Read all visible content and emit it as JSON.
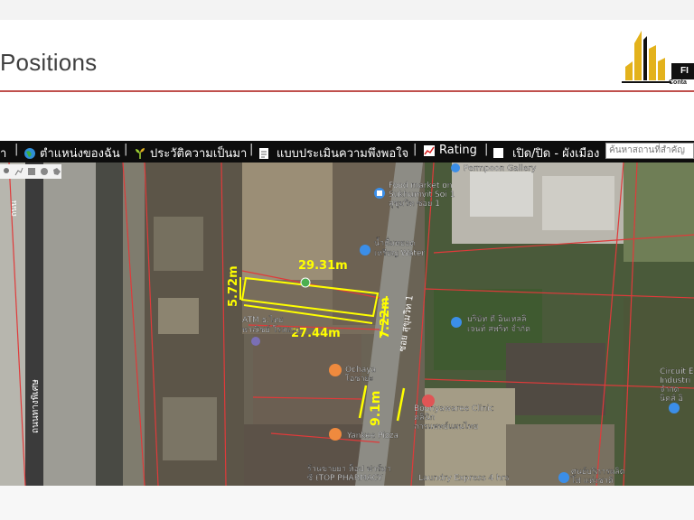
{
  "slide": {
    "title": "Positions",
    "logo_fi": "FI",
    "logo_sub": "Conta"
  },
  "toolbar": {
    "items": [
      {
        "label": "ำ",
        "icon": "truncated-icon"
      },
      {
        "label": "ตำแหน่งของฉัน",
        "icon": "globe-icon"
      },
      {
        "label": "ประวัติความเป็นมา",
        "icon": "sprout-icon"
      },
      {
        "label": "แบบประเมินความพึงพอใจ",
        "icon": "document-icon"
      },
      {
        "label": "Rating",
        "icon": "chart-icon"
      },
      {
        "label": "เปิด/ปิด - ผังเมือง",
        "icon": "square-icon"
      }
    ],
    "search_placeholder": "ค้นหาสถานที่สำคัญ"
  },
  "map": {
    "labels": {
      "gallery": "Permpoon Gallery",
      "food1": "Food market on",
      "food2": "Sukhumvit Soi 1",
      "food3": "สุขุมวิท ซอย 1",
      "water1": "น้ำดื่มหยอด",
      "water2": "เหรียญ Water",
      "atm1": "ATM ธ.ไทย",
      "atm2": "พาณิชย์ โรงแรม",
      "ochaya1": "Ochaya",
      "ochaya2": "โอชายะ",
      "yankee": "Yankee Pizza",
      "clinic1": "Boonyawaree Clinic",
      "clinic2": "คลินิก",
      "clinic3": "การแพทย์แผนไทย",
      "company1": "บริษัท ดี อินเทลลิ",
      "company2": "เจนท์ สพริท จำกัด",
      "circuit1": "Circuit E",
      "circuit2": "Industri",
      "circuit3": "จำกัด",
      "circuit4": "นิคส์ อิ",
      "pharmacy1": "ร้านขายยา ท็อป ฟาร์มา",
      "pharmacy2": "ซี (TOP PHARMACY",
      "laundry": "Laundry Express 4 hrs",
      "bottomright1": "ศูนย์บริการผลิต",
      "bottomright2": "ไฟ แห่งชาติ",
      "road_vertical": "ซอย สุขุมวิท 1",
      "road_left1": "ถนนทางพิเศษ",
      "road_left2": "ถนน"
    },
    "dimensions": {
      "top": "29.31m",
      "bottom": "27.44m",
      "left": "5.72m",
      "right": "7.22m",
      "road": "9.1m"
    }
  },
  "colors": {
    "rule": "#c0504d",
    "toolbar_bg": "#0d0d0d",
    "dimension": "#ffff00",
    "boundary": "#e03a3a"
  }
}
